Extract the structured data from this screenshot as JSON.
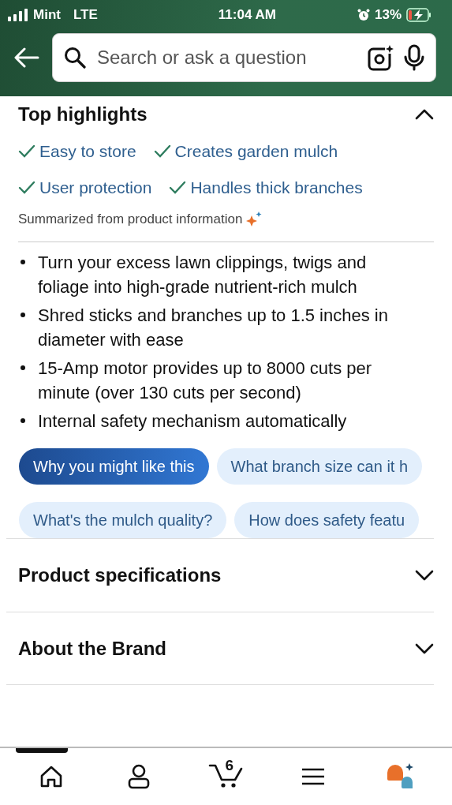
{
  "status_bar": {
    "carrier": "Mint",
    "network": "LTE",
    "time": "11:04 AM",
    "battery": "13%"
  },
  "search": {
    "placeholder": "Search or ask a question"
  },
  "top_highlights": {
    "title": "Top highlights",
    "expanded": true,
    "tags": [
      "Easy to store",
      "Creates garden mulch",
      "User protection",
      "Handles thick branches"
    ],
    "summary": "Summarized from product information",
    "bullets": [
      "Turn your excess lawn clippings, twigs and foliage into high-grade nutrient-rich mulch",
      "Shred sticks and branches up to 1.5 inches in diameter with ease",
      "15-Amp motor provides up to 8000 cuts per minute (over 130 cuts per second)",
      "Internal safety mechanism automatically"
    ]
  },
  "question_chips": [
    [
      {
        "label": "Why you might like this",
        "selected": true
      },
      {
        "label": "What branch size can it h",
        "selected": false
      }
    ],
    [
      {
        "label": "What's the mulch quality?",
        "selected": false
      },
      {
        "label": "How does safety featu",
        "selected": false
      }
    ]
  ],
  "sections": [
    {
      "title": "Product specifications",
      "expanded": false
    },
    {
      "title": "About the Brand",
      "expanded": false
    }
  ],
  "bottom_nav": [
    {
      "kind": "home",
      "selected": true
    },
    {
      "kind": "account",
      "selected": false
    },
    {
      "kind": "cart",
      "badge": "6",
      "selected": false
    },
    {
      "kind": "menu",
      "selected": false
    },
    {
      "kind": "assistant",
      "selected": false
    }
  ]
}
